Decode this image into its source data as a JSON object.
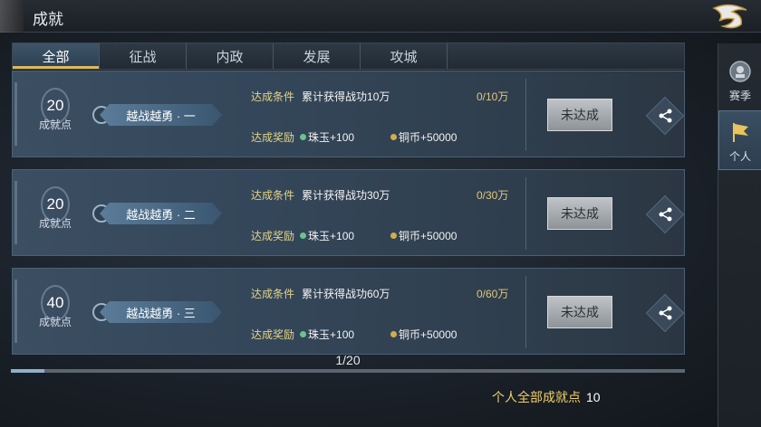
{
  "header": {
    "title": "成就",
    "back_icon": "dragon-back-icon"
  },
  "tabs": [
    {
      "label": "全部",
      "active": true
    },
    {
      "label": "征战",
      "active": false
    },
    {
      "label": "内政",
      "active": false
    },
    {
      "label": "发展",
      "active": false
    },
    {
      "label": "攻城",
      "active": false
    }
  ],
  "achievements": [
    {
      "points": "20",
      "points_label": "成就点",
      "name": "越战越勇 · 一",
      "cond_label": "达成条件",
      "cond_text": "累计获得战功10万",
      "progress": "0/10万",
      "reward_label": "达成奖励",
      "reward1": "珠玉+100",
      "reward2": "铜币+50000",
      "button": "未达成"
    },
    {
      "points": "20",
      "points_label": "成就点",
      "name": "越战越勇 · 二",
      "cond_label": "达成条件",
      "cond_text": "累计获得战功30万",
      "progress": "0/30万",
      "reward_label": "达成奖励",
      "reward1": "珠玉+100",
      "reward2": "铜币+50000",
      "button": "未达成"
    },
    {
      "points": "40",
      "points_label": "成就点",
      "name": "越战越勇 · 三",
      "cond_label": "达成条件",
      "cond_text": "累计获得战功60万",
      "progress": "0/60万",
      "reward_label": "达成奖励",
      "reward1": "珠玉+100",
      "reward2": "铜币+50000",
      "button": "未达成"
    }
  ],
  "pager": {
    "text": "1/20",
    "fraction": 0.05
  },
  "footer": {
    "total_label": "个人全部成就点",
    "total_value": "10"
  },
  "side": [
    {
      "label": "赛季",
      "icon": "season-icon",
      "active": false
    },
    {
      "label": "个人",
      "icon": "flag-icon",
      "active": true
    }
  ],
  "colors": {
    "accent_gold": "#e4d38a",
    "active_tab": "#3e5468"
  }
}
